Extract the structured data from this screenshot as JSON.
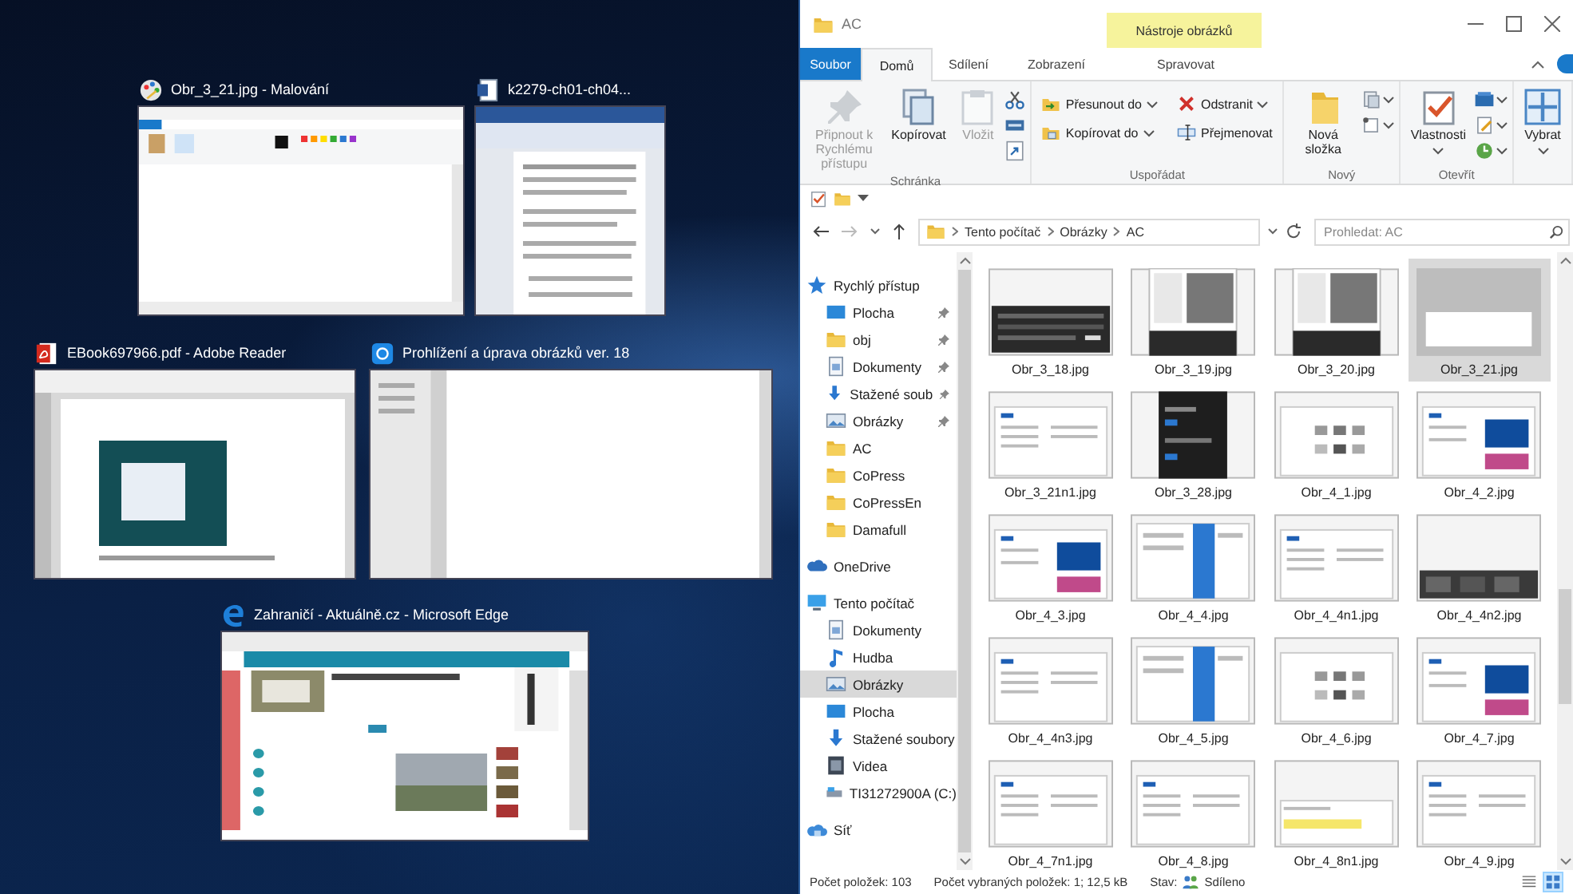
{
  "task_view": {
    "windows": [
      {
        "title": "Obr_3_21.jpg - Malování",
        "kind": "paint"
      },
      {
        "title": "k2279-ch01-ch04...",
        "kind": "word"
      },
      {
        "title": "EBook697966.pdf - Adobe Reader",
        "kind": "pdf"
      },
      {
        "title": "Prohlížení a úprava obrázků ver. 18",
        "kind": "photos"
      },
      {
        "title": "Zahraničí - Aktuálně.cz - Microsoft Edge",
        "kind": "edge"
      }
    ]
  },
  "explorer": {
    "title": "AC",
    "tool_group": "Nástroje obrázků",
    "tabs": [
      {
        "label": "Soubor",
        "kind": "file",
        "selected": false
      },
      {
        "label": "Domů",
        "kind": "normal",
        "selected": true
      },
      {
        "label": "Sdílení",
        "kind": "normal",
        "selected": false
      },
      {
        "label": "Zobrazení",
        "kind": "normal",
        "selected": false
      },
      {
        "label": "Spravovat",
        "kind": "normal",
        "selected": false
      }
    ],
    "ribbon": [
      {
        "label": "Schránka",
        "commands": [
          {
            "kind": "large",
            "label": "Připnout k Rychlému přístupu",
            "disabled": true,
            "dropdown": false
          },
          {
            "kind": "large",
            "label": "Kopírovat",
            "disabled": false,
            "dropdown": false
          },
          {
            "kind": "large",
            "label": "Vložit",
            "disabled": true,
            "dropdown": false
          },
          {
            "kind": "icons",
            "disabled": false,
            "dropdown": false
          }
        ]
      },
      {
        "label": "Uspořádat",
        "commands": [
          {
            "kind": "small",
            "label": "Přesunout do",
            "disabled": false,
            "dropdown": true
          },
          {
            "kind": "small",
            "label": "Odstranit",
            "disabled": false,
            "dropdown": true
          },
          {
            "kind": "small",
            "label": "Kopírovat do",
            "disabled": false,
            "dropdown": true
          },
          {
            "kind": "small",
            "label": "Přejmenovat",
            "disabled": false,
            "dropdown": false
          }
        ]
      },
      {
        "label": "Nový",
        "commands": [
          {
            "kind": "large",
            "label": "Nová složka",
            "disabled": false,
            "dropdown": false
          },
          {
            "kind": "icons",
            "disabled": false,
            "dropdown": true
          }
        ]
      },
      {
        "label": "Otevřít",
        "commands": [
          {
            "kind": "large",
            "label": "Vlastnosti",
            "disabled": false,
            "dropdown": true
          },
          {
            "kind": "icons",
            "disabled": false,
            "dropdown": true
          }
        ]
      },
      {
        "commands": [
          {
            "kind": "large",
            "label": "Vybrat",
            "disabled": false,
            "dropdown": true
          }
        ]
      }
    ],
    "address": {
      "path": [
        "Tento počítač",
        "Obrázky",
        "AC"
      ]
    },
    "search": {
      "placeholder": "Prohledat: AC"
    },
    "nav": [
      {
        "label": "Rychlý přístup",
        "kind": "star",
        "selected": false,
        "children": [
          {
            "label": "Plocha",
            "kind": "desktop",
            "selected": false,
            "pinned": true
          },
          {
            "label": "obj",
            "kind": "folder",
            "selected": false,
            "pinned": true
          },
          {
            "label": "Dokumenty",
            "kind": "documents",
            "selected": false,
            "pinned": true
          },
          {
            "label": "Stažené soub",
            "kind": "download",
            "selected": false,
            "pinned": true
          },
          {
            "label": "Obrázky",
            "kind": "pictures",
            "selected": false,
            "pinned": true
          },
          {
            "label": "AC",
            "kind": "folder",
            "selected": false,
            "pinned": false
          },
          {
            "label": "CoPress",
            "kind": "folder",
            "selected": false,
            "pinned": false
          },
          {
            "label": "CoPressEn",
            "kind": "folder",
            "selected": false,
            "pinned": false
          },
          {
            "label": "Damafull",
            "kind": "folder",
            "selected": false,
            "pinned": false
          }
        ]
      },
      {
        "label": "OneDrive",
        "kind": "onedrive",
        "selected": false
      },
      {
        "label": "Tento počítač",
        "kind": "pc",
        "selected": false,
        "children": [
          {
            "label": "Dokumenty",
            "kind": "documents",
            "selected": false
          },
          {
            "label": "Hudba",
            "kind": "music",
            "selected": false
          },
          {
            "label": "Obrázky",
            "kind": "pictures",
            "selected": true
          },
          {
            "label": "Plocha",
            "kind": "desktop",
            "selected": false
          },
          {
            "label": "Stažené soubory",
            "kind": "download",
            "selected": false
          },
          {
            "label": "Videa",
            "kind": "video",
            "selected": false
          },
          {
            "label": "TI31272900A (C:)",
            "kind": "drive",
            "selected": false
          }
        ]
      },
      {
        "label": "Síť",
        "kind": "network",
        "selected": false
      }
    ],
    "files": [
      {
        "name": "Obr_3_18.jpg",
        "selected": false
      },
      {
        "name": "Obr_3_19.jpg",
        "selected": false
      },
      {
        "name": "Obr_3_20.jpg",
        "selected": false
      },
      {
        "name": "Obr_3_21.jpg",
        "selected": true
      },
      {
        "name": "Obr_3_21n1.jpg",
        "selected": false
      },
      {
        "name": "Obr_3_28.jpg",
        "selected": false
      },
      {
        "name": "Obr_4_1.jpg",
        "selected": false
      },
      {
        "name": "Obr_4_2.jpg",
        "selected": false
      },
      {
        "name": "Obr_4_3.jpg",
        "selected": false
      },
      {
        "name": "Obr_4_4.jpg",
        "selected": false
      },
      {
        "name": "Obr_4_4n1.jpg",
        "selected": false
      },
      {
        "name": "Obr_4_4n2.jpg",
        "selected": false
      },
      {
        "name": "Obr_4_4n3.jpg",
        "selected": false
      },
      {
        "name": "Obr_4_5.jpg",
        "selected": false
      },
      {
        "name": "Obr_4_6.jpg",
        "selected": false
      },
      {
        "name": "Obr_4_7.jpg",
        "selected": false
      },
      {
        "name": "Obr_4_7n1.jpg",
        "selected": false
      },
      {
        "name": "Obr_4_8.jpg",
        "selected": false
      },
      {
        "name": "Obr_4_8n1.jpg",
        "selected": false
      },
      {
        "name": "Obr_4_9.jpg",
        "selected": false
      }
    ],
    "status": {
      "items_count": "Počet položek: 103",
      "selected_count": "Počet vybraných položek: 1; 12,5 kB",
      "state_label": "Stav:",
      "state_value": "Sdíleno"
    },
    "views": [
      {
        "kind": "details",
        "selected": false
      },
      {
        "kind": "thumbnails",
        "selected": true
      }
    ]
  }
}
